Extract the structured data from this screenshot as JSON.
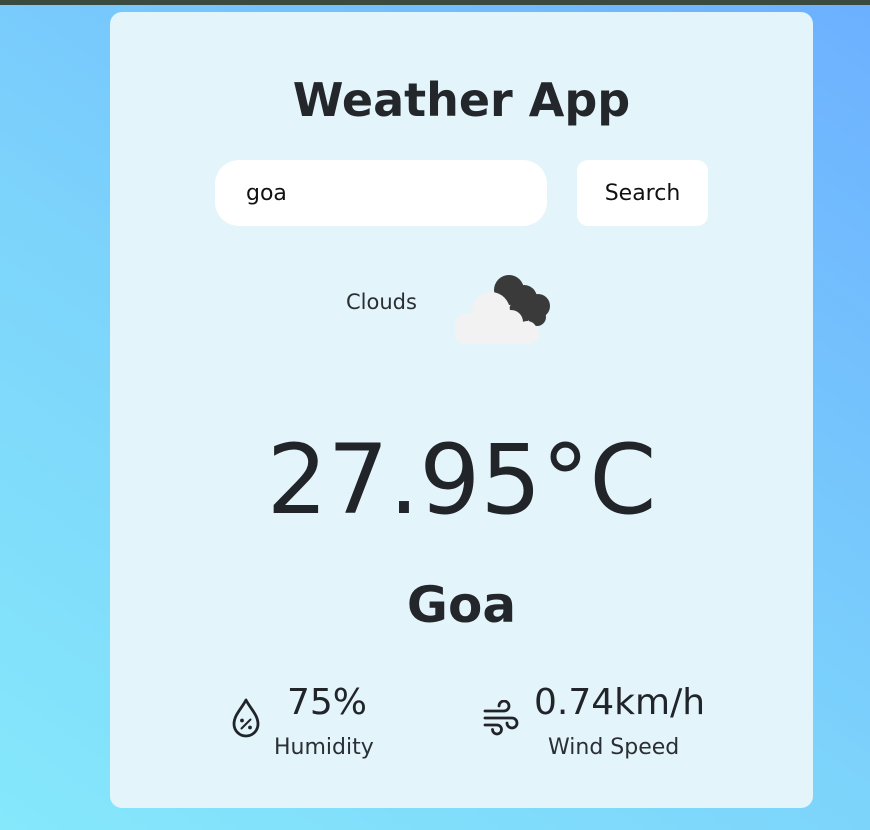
{
  "app": {
    "title": "Weather App"
  },
  "search": {
    "value": "goa",
    "button_label": "Search"
  },
  "weather": {
    "condition": "Clouds",
    "condition_icon": "clouds-icon",
    "temperature": "27.95°C",
    "city": "Goa"
  },
  "stats": {
    "humidity": {
      "value": "75%",
      "label": "Humidity",
      "icon": "humidity-drop-icon"
    },
    "wind": {
      "value": "0.74km/h",
      "label": "Wind Speed",
      "icon": "wind-icon"
    }
  },
  "colors": {
    "card_background": "#e3f4fa",
    "page_gradient_start": "#85e8fb",
    "page_gradient_end": "#6cb0ff",
    "text": "#212529"
  }
}
